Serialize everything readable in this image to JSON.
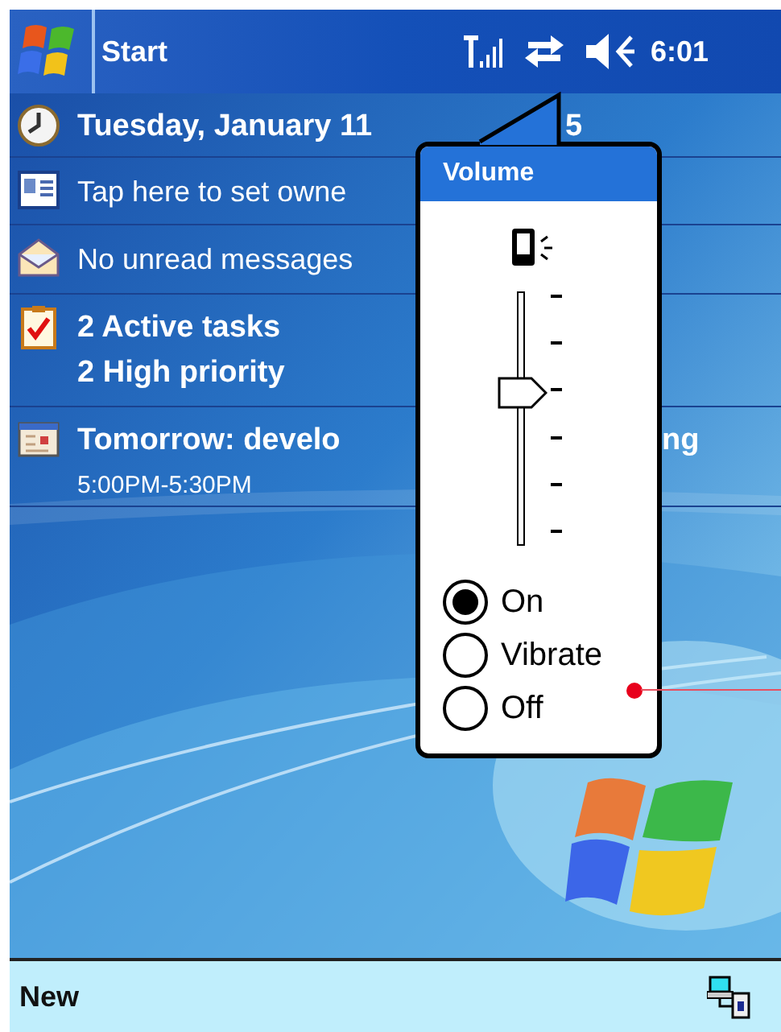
{
  "title_bar": {
    "start": "Start",
    "time": "6:01"
  },
  "today_items": [
    {
      "kind": "date",
      "lines": [
        {
          "text": "Tuesday, January 11",
          "after_popup": "5",
          "bold": true
        }
      ]
    },
    {
      "kind": "owner",
      "lines": [
        {
          "text": "Tap here to set owne",
          "bold": false
        }
      ]
    },
    {
      "kind": "messages",
      "lines": [
        {
          "text": "No unread messages",
          "bold": false
        }
      ]
    },
    {
      "kind": "tasks",
      "lines": [
        {
          "text": "2 Active tasks",
          "bold": true
        },
        {
          "text": "2 High priority",
          "bold": true
        }
      ]
    },
    {
      "kind": "calendar",
      "lines": [
        {
          "text": "Tomorrow: develo",
          "after_popup": "ng",
          "bold": true
        },
        {
          "text": "5:00PM-5:30PM",
          "bold": false
        }
      ]
    }
  ],
  "volume_popup": {
    "title": "Volume",
    "level": 0.6,
    "modes": [
      {
        "label": "On",
        "selected": true
      },
      {
        "label": "Vibrate",
        "selected": false
      },
      {
        "label": "Off",
        "selected": false
      }
    ]
  },
  "menu_bar": {
    "left": "New"
  }
}
